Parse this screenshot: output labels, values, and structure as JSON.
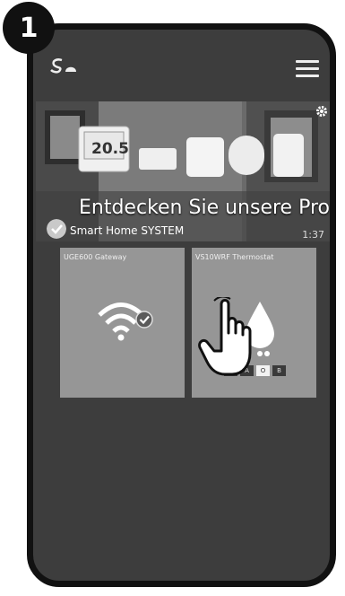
{
  "step": {
    "number": "1"
  },
  "header": {
    "logo_icon": "salus-logo-icon",
    "menu_icon": "hamburger-menu-icon"
  },
  "banner": {
    "title": "Entdecken Sie unsere Pro...",
    "subtitle": "Smart Home SYSTEM",
    "duration": "1:37",
    "device_display": "20.5",
    "settings_icon": "gear-icon",
    "check_icon": "check-icon"
  },
  "devices": [
    {
      "name": "UGE600 Gateway",
      "icon": "wifi-icon",
      "status_icon": "check-icon"
    },
    {
      "name": "VS10WRF Thermostat",
      "icon": "water-drop-icon",
      "modes": [
        "I",
        "A",
        "O",
        "B"
      ],
      "active_mode": "O"
    }
  ],
  "overlay": {
    "icon": "tapping-hand-icon"
  },
  "colors": {
    "background": "#3d3d3d",
    "tile": "#969696",
    "frame": "#111111"
  }
}
